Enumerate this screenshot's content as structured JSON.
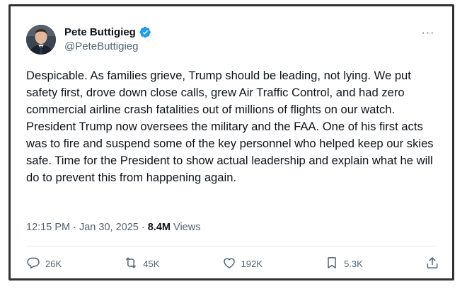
{
  "author": {
    "display_name": "Pete Buttigieg",
    "handle": "@PeteButtigieg"
  },
  "more_menu_glyph": "···",
  "tweet": {
    "paragraphs": [
      "Despicable. As families grieve, Trump should be leading, not lying. We put safety first, drove down close calls, grew Air Traffic Control, and had zero commercial airline crash fatalities out of millions of flights on our watch.",
      "President Trump now oversees the military and the FAA. One of his first acts was to fire and suspend some of the key personnel who helped keep our skies safe. Time for the President to show actual leadership and explain what he will do to prevent this from happening again."
    ]
  },
  "meta": {
    "time": "12:15 PM",
    "separator": "·",
    "date": "Jan 30, 2025",
    "views_count": "8.4M",
    "views_label": "Views"
  },
  "actions": {
    "replies": "26K",
    "reposts": "45K",
    "likes": "192K",
    "bookmarks": "5.3K"
  },
  "colors": {
    "verified": "#1d9bf0",
    "muted_text": "#536471",
    "main_text": "#0f1419"
  },
  "icons": {
    "verified": "verified-badge-icon",
    "reply": "speech-bubble-icon",
    "repost": "repost-arrows-icon",
    "like": "heart-icon",
    "bookmark": "bookmark-icon",
    "share": "share-upload-icon"
  }
}
